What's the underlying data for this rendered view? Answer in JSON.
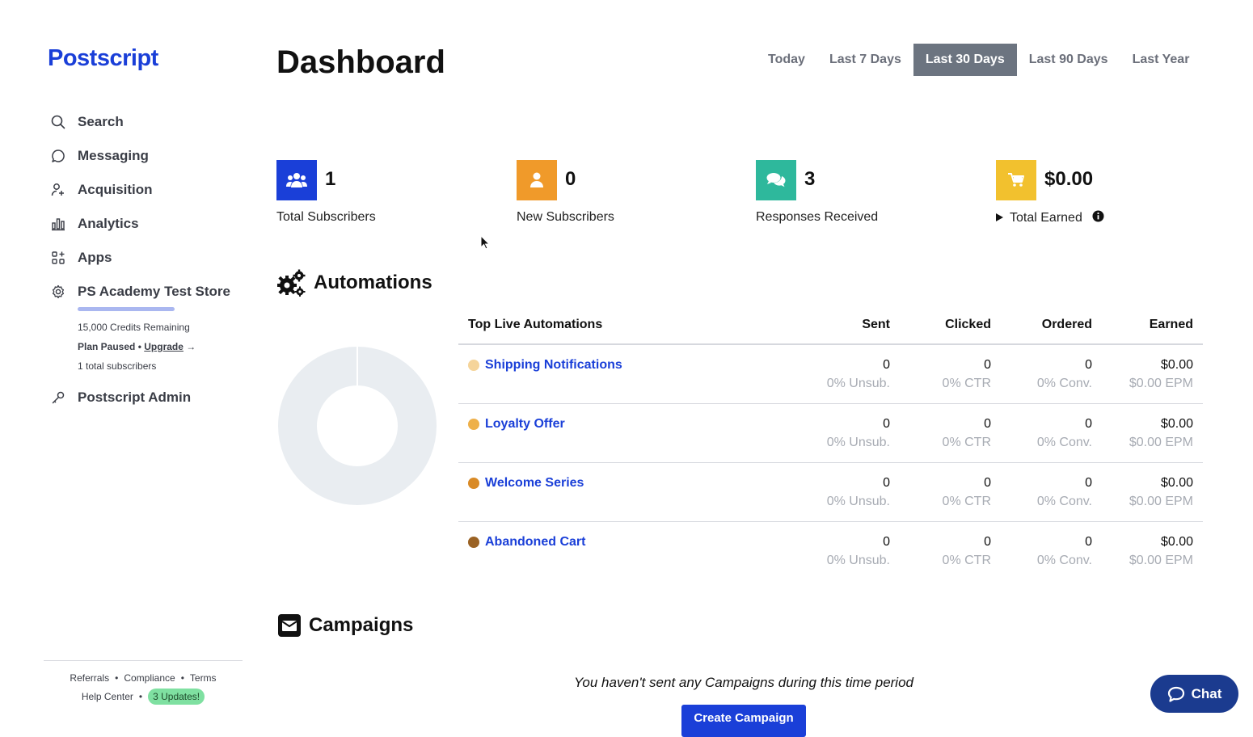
{
  "sidebar": {
    "logo": "Postscript",
    "items": [
      {
        "label": "Search",
        "icon": "search-icon"
      },
      {
        "label": "Messaging",
        "icon": "chat-bubble-icon"
      },
      {
        "label": "Acquisition",
        "icon": "user-plus-icon"
      },
      {
        "label": "Analytics",
        "icon": "bar-chart-icon"
      },
      {
        "label": "Apps",
        "icon": "apps-grid-icon"
      },
      {
        "label": "PS Academy Test Store",
        "icon": "gear-icon"
      }
    ],
    "store": {
      "credits": "15,000 Credits Remaining",
      "plan_status": "Plan Paused •",
      "upgrade": "Upgrade",
      "upgrade_arrow": "→",
      "subscribers": "1 total subscribers"
    },
    "admin": {
      "label": "Postscript Admin",
      "icon": "key-icon"
    },
    "footer": {
      "referrals": "Referrals",
      "compliance": "Compliance",
      "terms": "Terms",
      "help": "Help Center",
      "updates": "3 Updates!",
      "separator": "•"
    }
  },
  "header": {
    "title": "Dashboard",
    "ranges": [
      "Today",
      "Last 7 Days",
      "Last 30 Days",
      "Last 90 Days",
      "Last Year"
    ],
    "active_range": "Last 30 Days"
  },
  "stats": [
    {
      "value": "1",
      "label": "Total Subscribers",
      "color": "#1a3fd8",
      "icon": "users-icon"
    },
    {
      "value": "0",
      "label": "New Subscribers",
      "color": "#f09a2a",
      "icon": "user-icon"
    },
    {
      "value": "3",
      "label": "Responses Received",
      "color": "#2eb89c",
      "icon": "comments-icon"
    },
    {
      "value": "$0.00",
      "label": "Total Earned",
      "color": "#f2c12e",
      "icon": "cart-icon"
    }
  ],
  "automations": {
    "title": "Automations",
    "columns": [
      "Top Live Automations",
      "Sent",
      "Clicked",
      "Ordered",
      "Earned"
    ],
    "rows": [
      {
        "name": "Shipping Notifications",
        "color": "#f5d49a",
        "sent": "0",
        "sent_sub": "0% Unsub.",
        "clicked": "0",
        "clicked_sub": "0% CTR",
        "ordered": "0",
        "ordered_sub": "0% Conv.",
        "earned": "$0.00",
        "earned_sub": "$0.00 EPM"
      },
      {
        "name": "Loyalty Offer",
        "color": "#eeb04a",
        "sent": "0",
        "sent_sub": "0% Unsub.",
        "clicked": "0",
        "clicked_sub": "0% CTR",
        "ordered": "0",
        "ordered_sub": "0% Conv.",
        "earned": "$0.00",
        "earned_sub": "$0.00 EPM"
      },
      {
        "name": "Welcome Series",
        "color": "#d98a26",
        "sent": "0",
        "sent_sub": "0% Unsub.",
        "clicked": "0",
        "clicked_sub": "0% CTR",
        "ordered": "0",
        "ordered_sub": "0% Conv.",
        "earned": "$0.00",
        "earned_sub": "$0.00 EPM"
      },
      {
        "name": "Abandoned Cart",
        "color": "#9a6224",
        "sent": "0",
        "sent_sub": "0% Unsub.",
        "clicked": "0",
        "clicked_sub": "0% CTR",
        "ordered": "0",
        "ordered_sub": "0% Conv.",
        "earned": "$0.00",
        "earned_sub": "$0.00 EPM"
      }
    ]
  },
  "campaigns": {
    "title": "Campaigns",
    "empty": "You haven't sent any Campaigns during this time period",
    "create_button": "Create Campaign"
  },
  "chat": {
    "label": "Chat"
  }
}
